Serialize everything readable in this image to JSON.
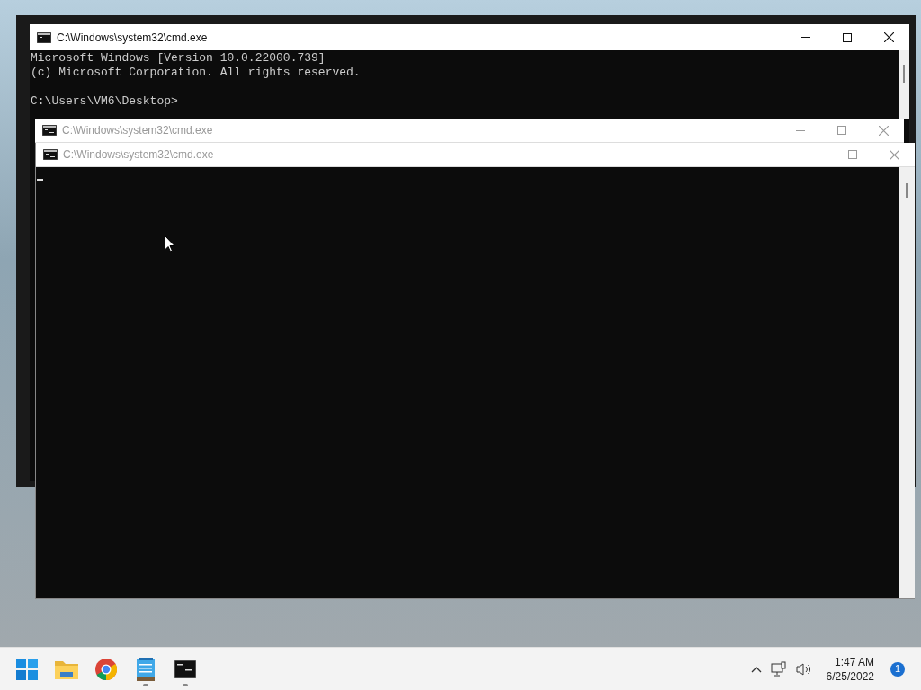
{
  "windows": [
    {
      "title": "C:\\Windows\\system32\\cmd.exe",
      "active": true,
      "output": [
        "Microsoft Windows [Version 10.0.22000.739]",
        "(c) Microsoft Corporation. All rights reserved."
      ],
      "prompt": "C:\\Users\\VM6\\Desktop>"
    },
    {
      "title": "C:\\Windows\\system32\\cmd.exe",
      "active": false
    },
    {
      "title": "C:\\Windows\\system32\\cmd.exe",
      "active": false
    }
  ],
  "taskbar": {
    "apps": [
      {
        "kind": "start",
        "running": false
      },
      {
        "kind": "folder",
        "running": false
      },
      {
        "kind": "browser",
        "running": false
      },
      {
        "kind": "notepad",
        "running": true
      },
      {
        "kind": "terminal",
        "running": true
      }
    ],
    "time": "1:47 AM",
    "date": "6/25/2022",
    "badge": "1"
  }
}
